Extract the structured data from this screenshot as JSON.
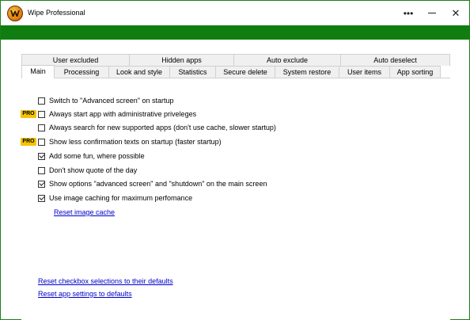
{
  "window": {
    "title": "Wipe Professional",
    "more_glyph": "•••",
    "close_glyph": "✕"
  },
  "tabs": {
    "row1": [
      "User excluded",
      "Hidden apps",
      "Auto exclude",
      "Auto deselect"
    ],
    "row2": [
      "Main",
      "Processing",
      "Look and style",
      "Statistics",
      "Secure delete",
      "System restore",
      "User items",
      "App sorting"
    ],
    "active": "Main"
  },
  "options": [
    {
      "label": "Switch to \"Advanced screen\" on startup",
      "checked": false,
      "pro": false
    },
    {
      "label": "Always start app with administrative priveleges",
      "checked": false,
      "pro": true
    },
    {
      "label": "Always search for new supported apps (don't use cache, slower startup)",
      "checked": false,
      "pro": false
    },
    {
      "label": "Show less confirmation texts on startup (faster startup)",
      "checked": false,
      "pro": true
    },
    {
      "label": "Add some fun, where possible",
      "checked": true,
      "pro": false
    },
    {
      "label": "Don't show quote of the day",
      "checked": false,
      "pro": false
    },
    {
      "label": "Show options \"advanced screen\" and \"shutdown\" on the main screen",
      "checked": true,
      "pro": false
    },
    {
      "label": "Use image caching for maximum perfomance",
      "checked": true,
      "pro": false
    }
  ],
  "pro_badge": "PRO",
  "links": {
    "reset_image_cache": "Reset image cache",
    "reset_checkbox": "Reset checkbox selections to their defaults",
    "reset_app_settings": "Reset app settings to defaults"
  },
  "colors": {
    "accent_green": "#0f7d0f",
    "pro_badge": "#f4c400",
    "link": "#0000cc"
  }
}
